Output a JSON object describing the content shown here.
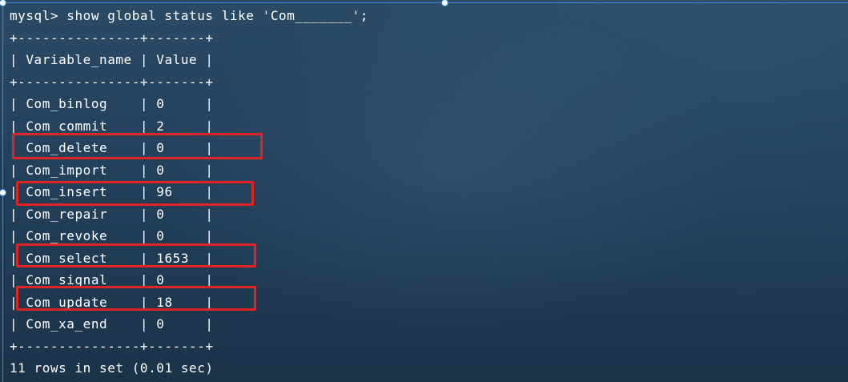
{
  "terminal": {
    "command_line": "mysql> show global status like 'Com_______';",
    "border_line": "+---------------+-------+",
    "header_line": "| Variable_name | Value |",
    "rows": [
      {
        "name": "Com_binlog",
        "value": "0",
        "text": "| Com_binlog    | 0     |"
      },
      {
        "name": "Com_commit",
        "value": "2",
        "text": "| Com_commit    | 2     |"
      },
      {
        "name": "Com_delete",
        "value": "0",
        "text": "| Com_delete    | 0     |"
      },
      {
        "name": "Com_import",
        "value": "0",
        "text": "| Com_import    | 0     |"
      },
      {
        "name": "Com_insert",
        "value": "96",
        "text": "| Com_insert    | 96    |"
      },
      {
        "name": "Com_repair",
        "value": "0",
        "text": "| Com_repair    | 0     |"
      },
      {
        "name": "Com_revoke",
        "value": "0",
        "text": "| Com_revoke    | 0     |"
      },
      {
        "name": "Com_select",
        "value": "1653",
        "text": "| Com_select    | 1653  |"
      },
      {
        "name": "Com_signal",
        "value": "0",
        "text": "| Com_signal    | 0     |"
      },
      {
        "name": "Com_update",
        "value": "18",
        "text": "| Com_update    | 18    |"
      },
      {
        "name": "Com_xa_end",
        "value": "0",
        "text": "| Com_xa_end    | 0     |"
      }
    ],
    "summary": "11 rows in set (0.01 sec)"
  },
  "highlighted_rows": [
    "Com_delete",
    "Com_insert",
    "Com_select",
    "Com_update"
  ],
  "colors": {
    "terminal_text": "#ffffff",
    "background": "#23405b",
    "highlight_box": "#e02323",
    "selection_frame": "#3a88e6"
  }
}
